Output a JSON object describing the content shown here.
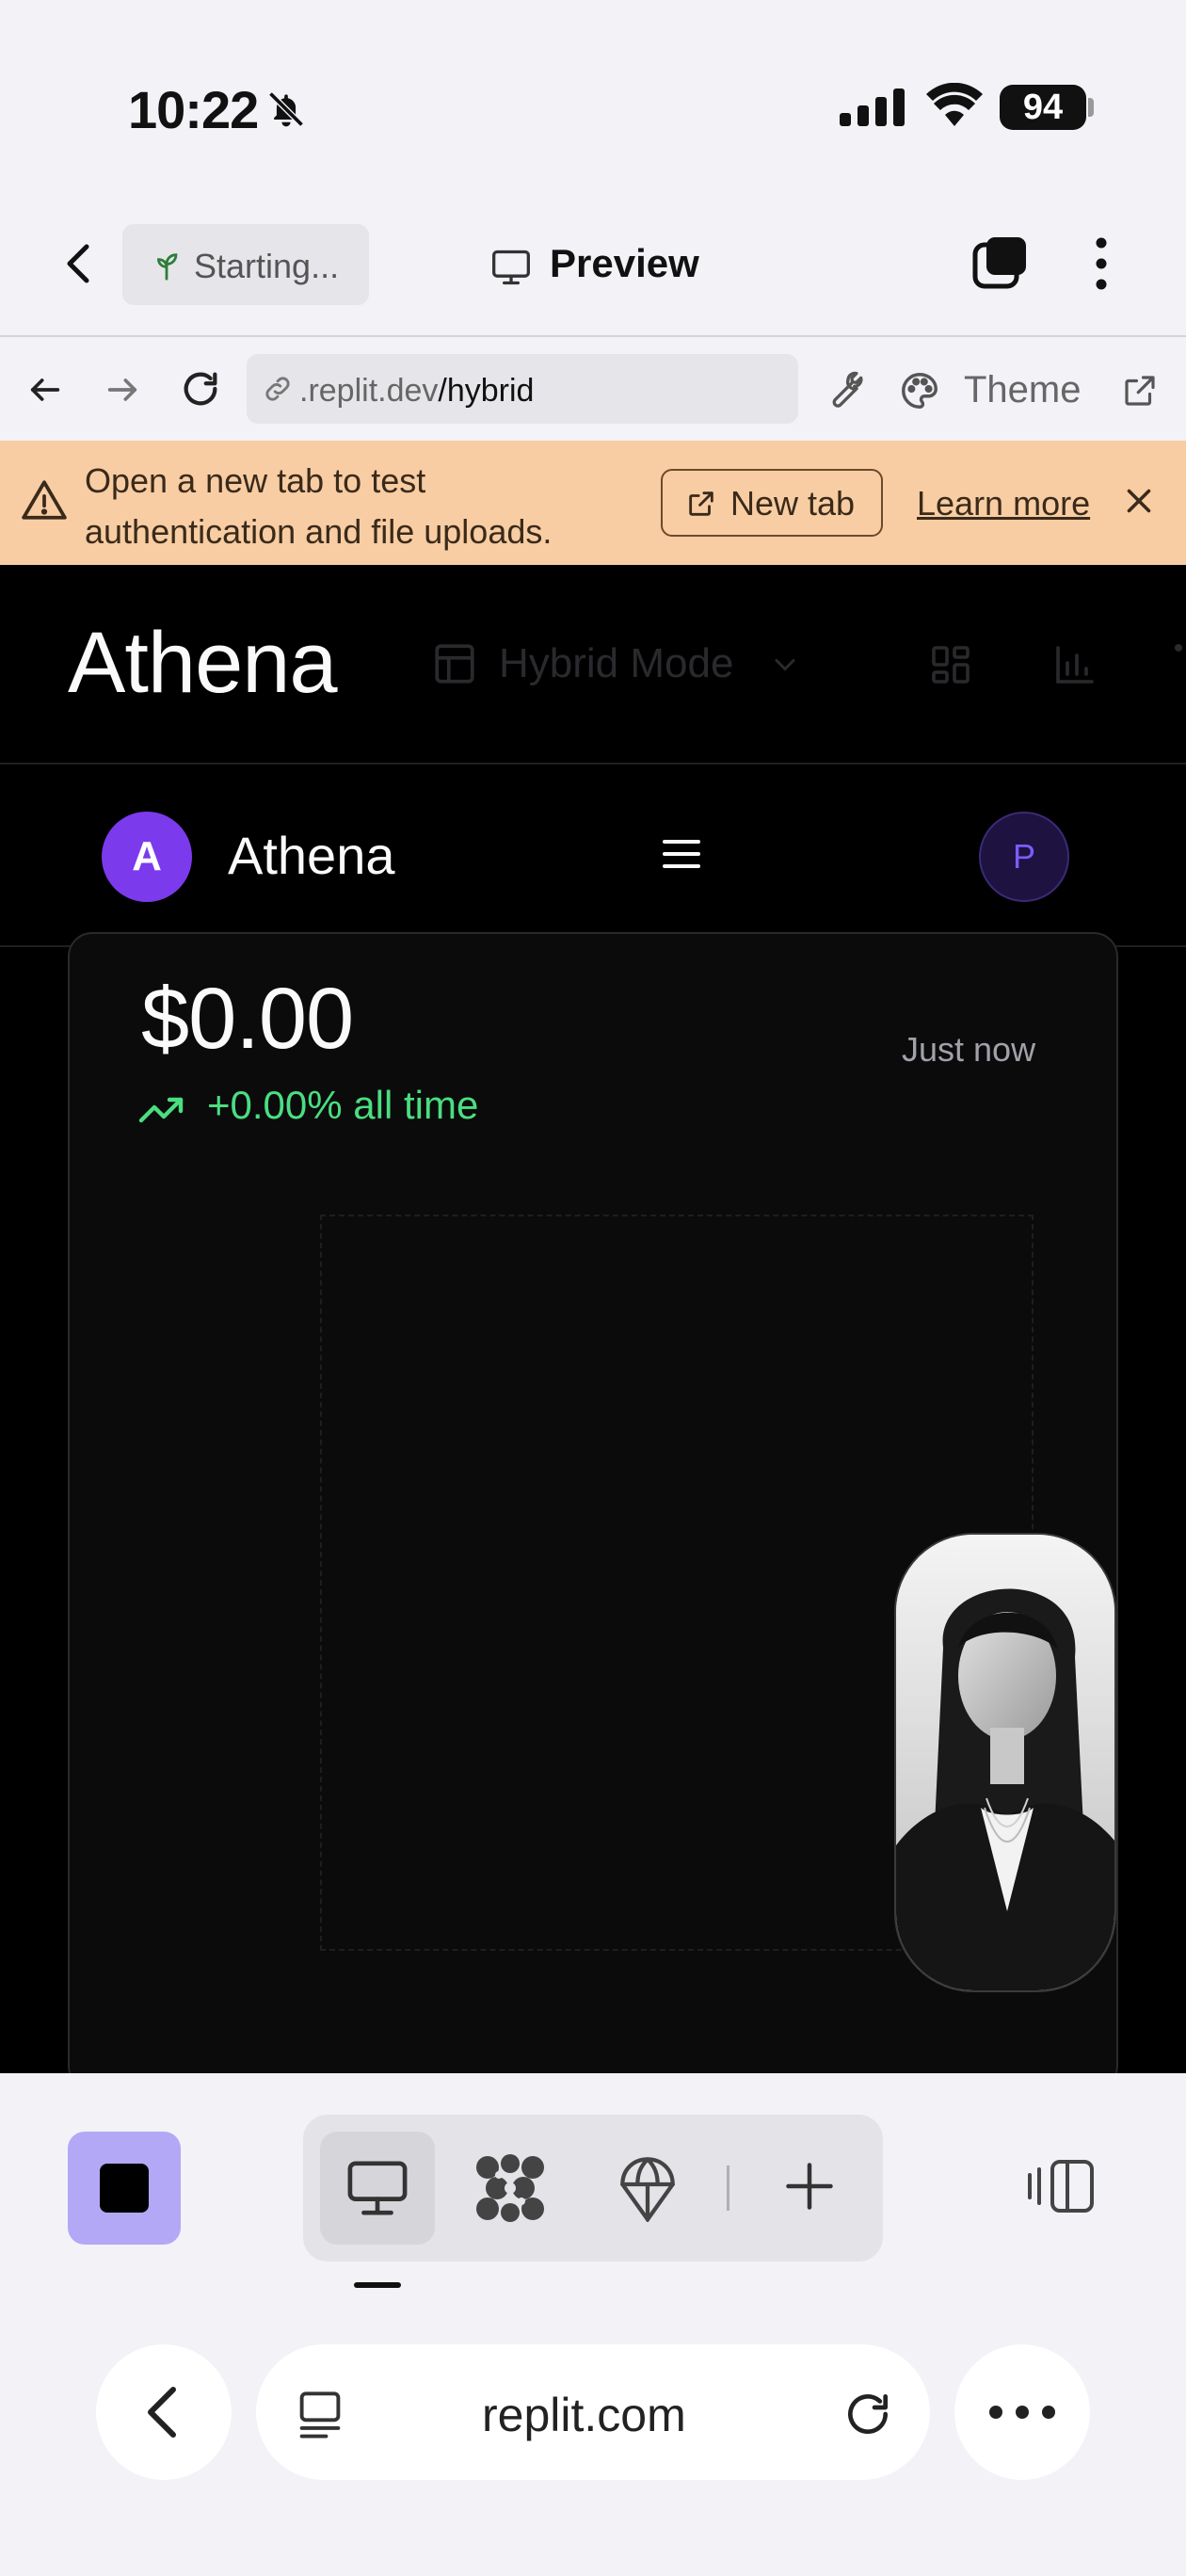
{
  "status_bar": {
    "time": "10:22",
    "battery": "94"
  },
  "app_header": {
    "status_label": "Starting...",
    "title": "Preview"
  },
  "url_bar": {
    "domain_prefix": ".replit.dev",
    "path": "/hybrid",
    "theme_label": "Theme"
  },
  "banner": {
    "message": "Open a new tab to test authentication and file uploads.",
    "new_tab_label": "New tab",
    "learn_more_label": "Learn more"
  },
  "web_app": {
    "brand": "Athena",
    "mode_label": "Hybrid Mode",
    "mobile_title": "Athena",
    "avatar_letter": "A",
    "profile_letter": "P",
    "balance": "$0.00",
    "updated": "Just now",
    "change": "+0.00% all time",
    "accent_color": "#7c3aed",
    "positive_color": "#4ade80"
  },
  "safari": {
    "domain": "replit.com"
  },
  "icons": [
    "bell-slash-icon",
    "cellular-signal-icon",
    "wifi-icon",
    "back-chevron-icon",
    "sprout-icon",
    "monitor-icon",
    "tabs-icon",
    "more-vertical-icon",
    "arrow-left-icon",
    "arrow-right-icon",
    "reload-icon",
    "link-icon",
    "wrench-icon",
    "palette-icon",
    "external-link-icon",
    "warning-icon",
    "close-icon",
    "layout-icon",
    "chevron-down-icon",
    "grid-icon",
    "bar-chart-icon",
    "hamburger-icon",
    "trend-up-icon",
    "stop-icon",
    "agent-icon",
    "deploy-icon",
    "plus-icon",
    "panel-toggle-icon",
    "tab-overview-icon",
    "ellipsis-icon"
  ]
}
